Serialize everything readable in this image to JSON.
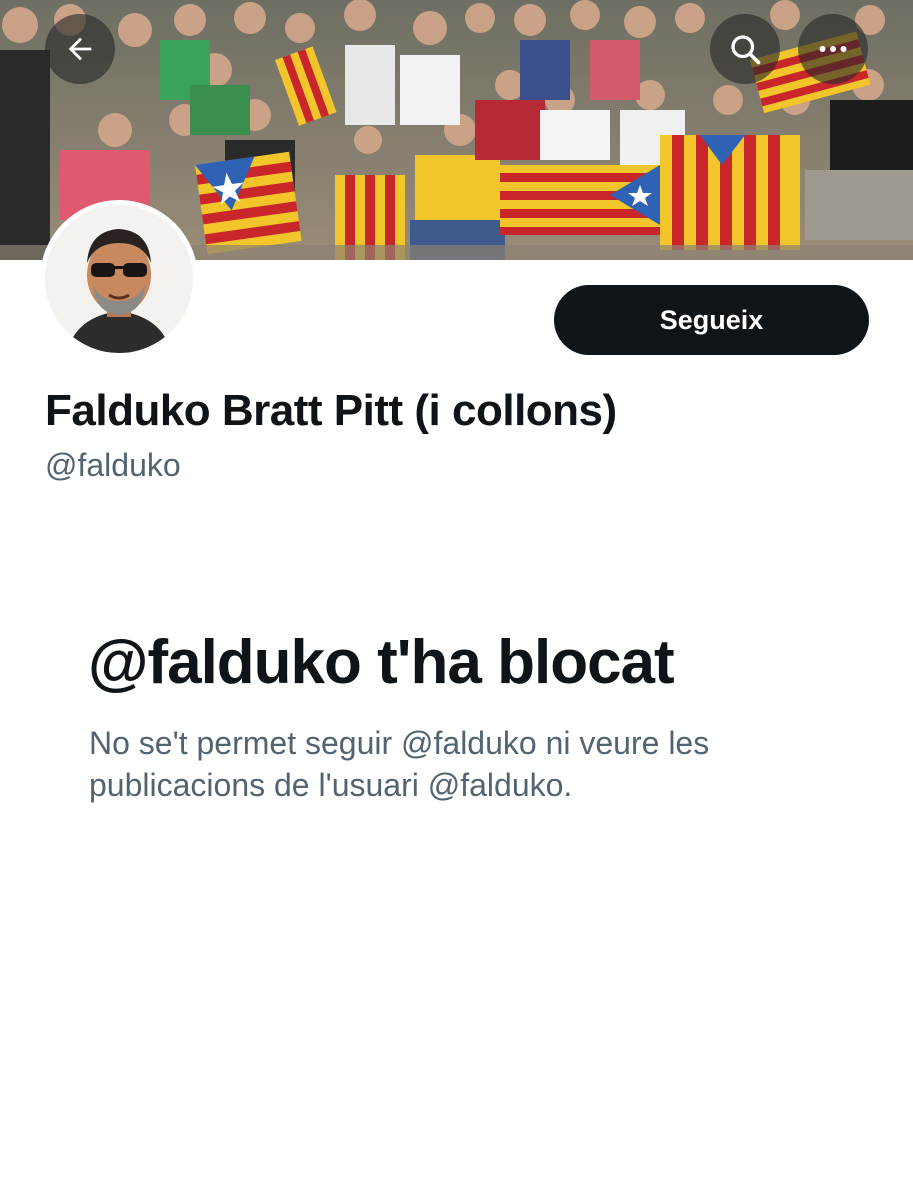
{
  "header": {
    "back_icon": "arrow-left-icon",
    "search_icon": "search-icon",
    "more_icon": "more-horizontal-icon",
    "banner_colors": {
      "flag_yellow": "#f2c62b",
      "flag_red": "#c8262b",
      "star_blue": "#2f62b5"
    }
  },
  "profile": {
    "display_name": "Falduko Bratt Pitt (i collons)",
    "handle": "@falduko",
    "follow_label": "Segueix"
  },
  "blocked": {
    "title": "@falduko t'ha blocat",
    "description": "No se't permet seguir @falduko ni veure les publicacions de l'usuari @falduko."
  },
  "colors": {
    "text_primary": "#0f1419",
    "text_secondary": "#536471",
    "button_bg": "#0f1419",
    "button_text": "#ffffff"
  }
}
